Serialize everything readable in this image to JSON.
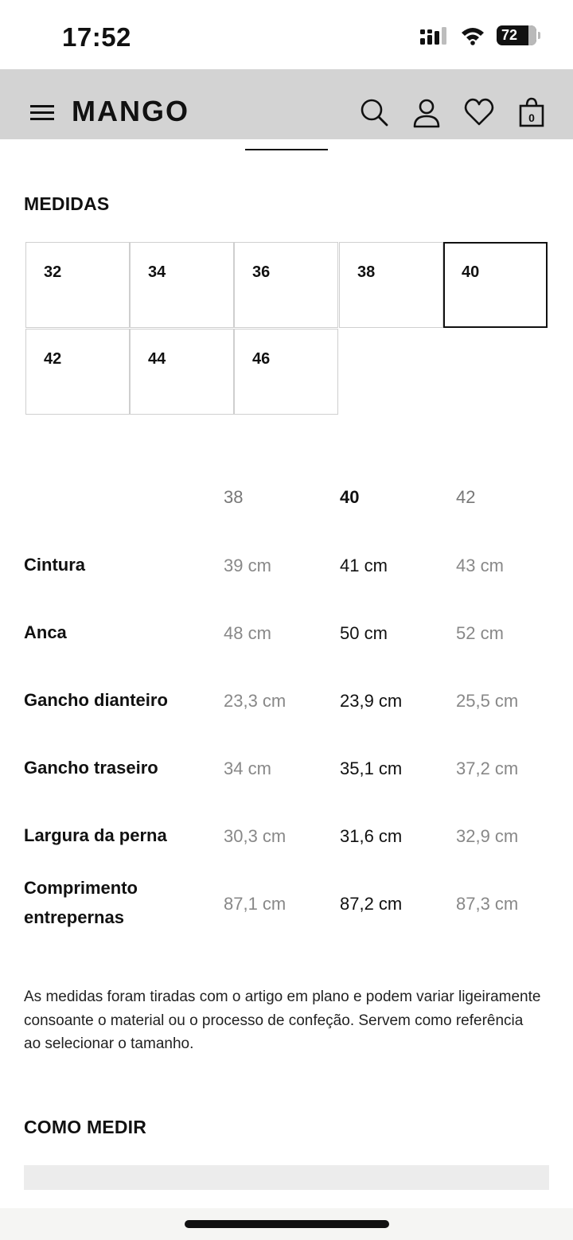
{
  "status_bar": {
    "time": "17:52",
    "battery": "72"
  },
  "header": {
    "logo": "MANGO",
    "bag_count": "0",
    "icons": [
      "menu-icon",
      "search-icon",
      "user-icon",
      "heart-icon",
      "bag-icon"
    ],
    "background": "#d3d3d3"
  },
  "measures": {
    "title": "MEDIDAS",
    "sizes": [
      "32",
      "34",
      "36",
      "38",
      "40",
      "42",
      "44",
      "46"
    ],
    "selected_size": "40"
  },
  "table": {
    "columns": [
      "38",
      "40",
      "42"
    ],
    "selected_column": "40",
    "rows": [
      {
        "label": "Cintura",
        "values": [
          "39 cm",
          "41 cm",
          "43 cm"
        ]
      },
      {
        "label": "Anca",
        "values": [
          "48 cm",
          "50 cm",
          "52 cm"
        ]
      },
      {
        "label": "Gancho dianteiro",
        "values": [
          "23,3 cm",
          "23,9 cm",
          "25,5 cm"
        ]
      },
      {
        "label": "Gancho traseiro",
        "values": [
          "34 cm",
          "35,1 cm",
          "37,2 cm"
        ]
      },
      {
        "label": "Largura da perna",
        "values": [
          "30,3 cm",
          "31,6 cm",
          "32,9 cm"
        ]
      },
      {
        "label_line1": "Comprimento",
        "label_line2": "entrepernas",
        "values": [
          "87,1 cm",
          "87,2 cm",
          "87,3 cm"
        ]
      }
    ]
  },
  "note": "As medidas foram tiradas com o artigo em plano e podem variar ligeiramente consoante o material ou o processo de confeção. Servem como referência ao selecionar o tamanho.",
  "how_to_measure": {
    "title": "COMO MEDIR"
  }
}
